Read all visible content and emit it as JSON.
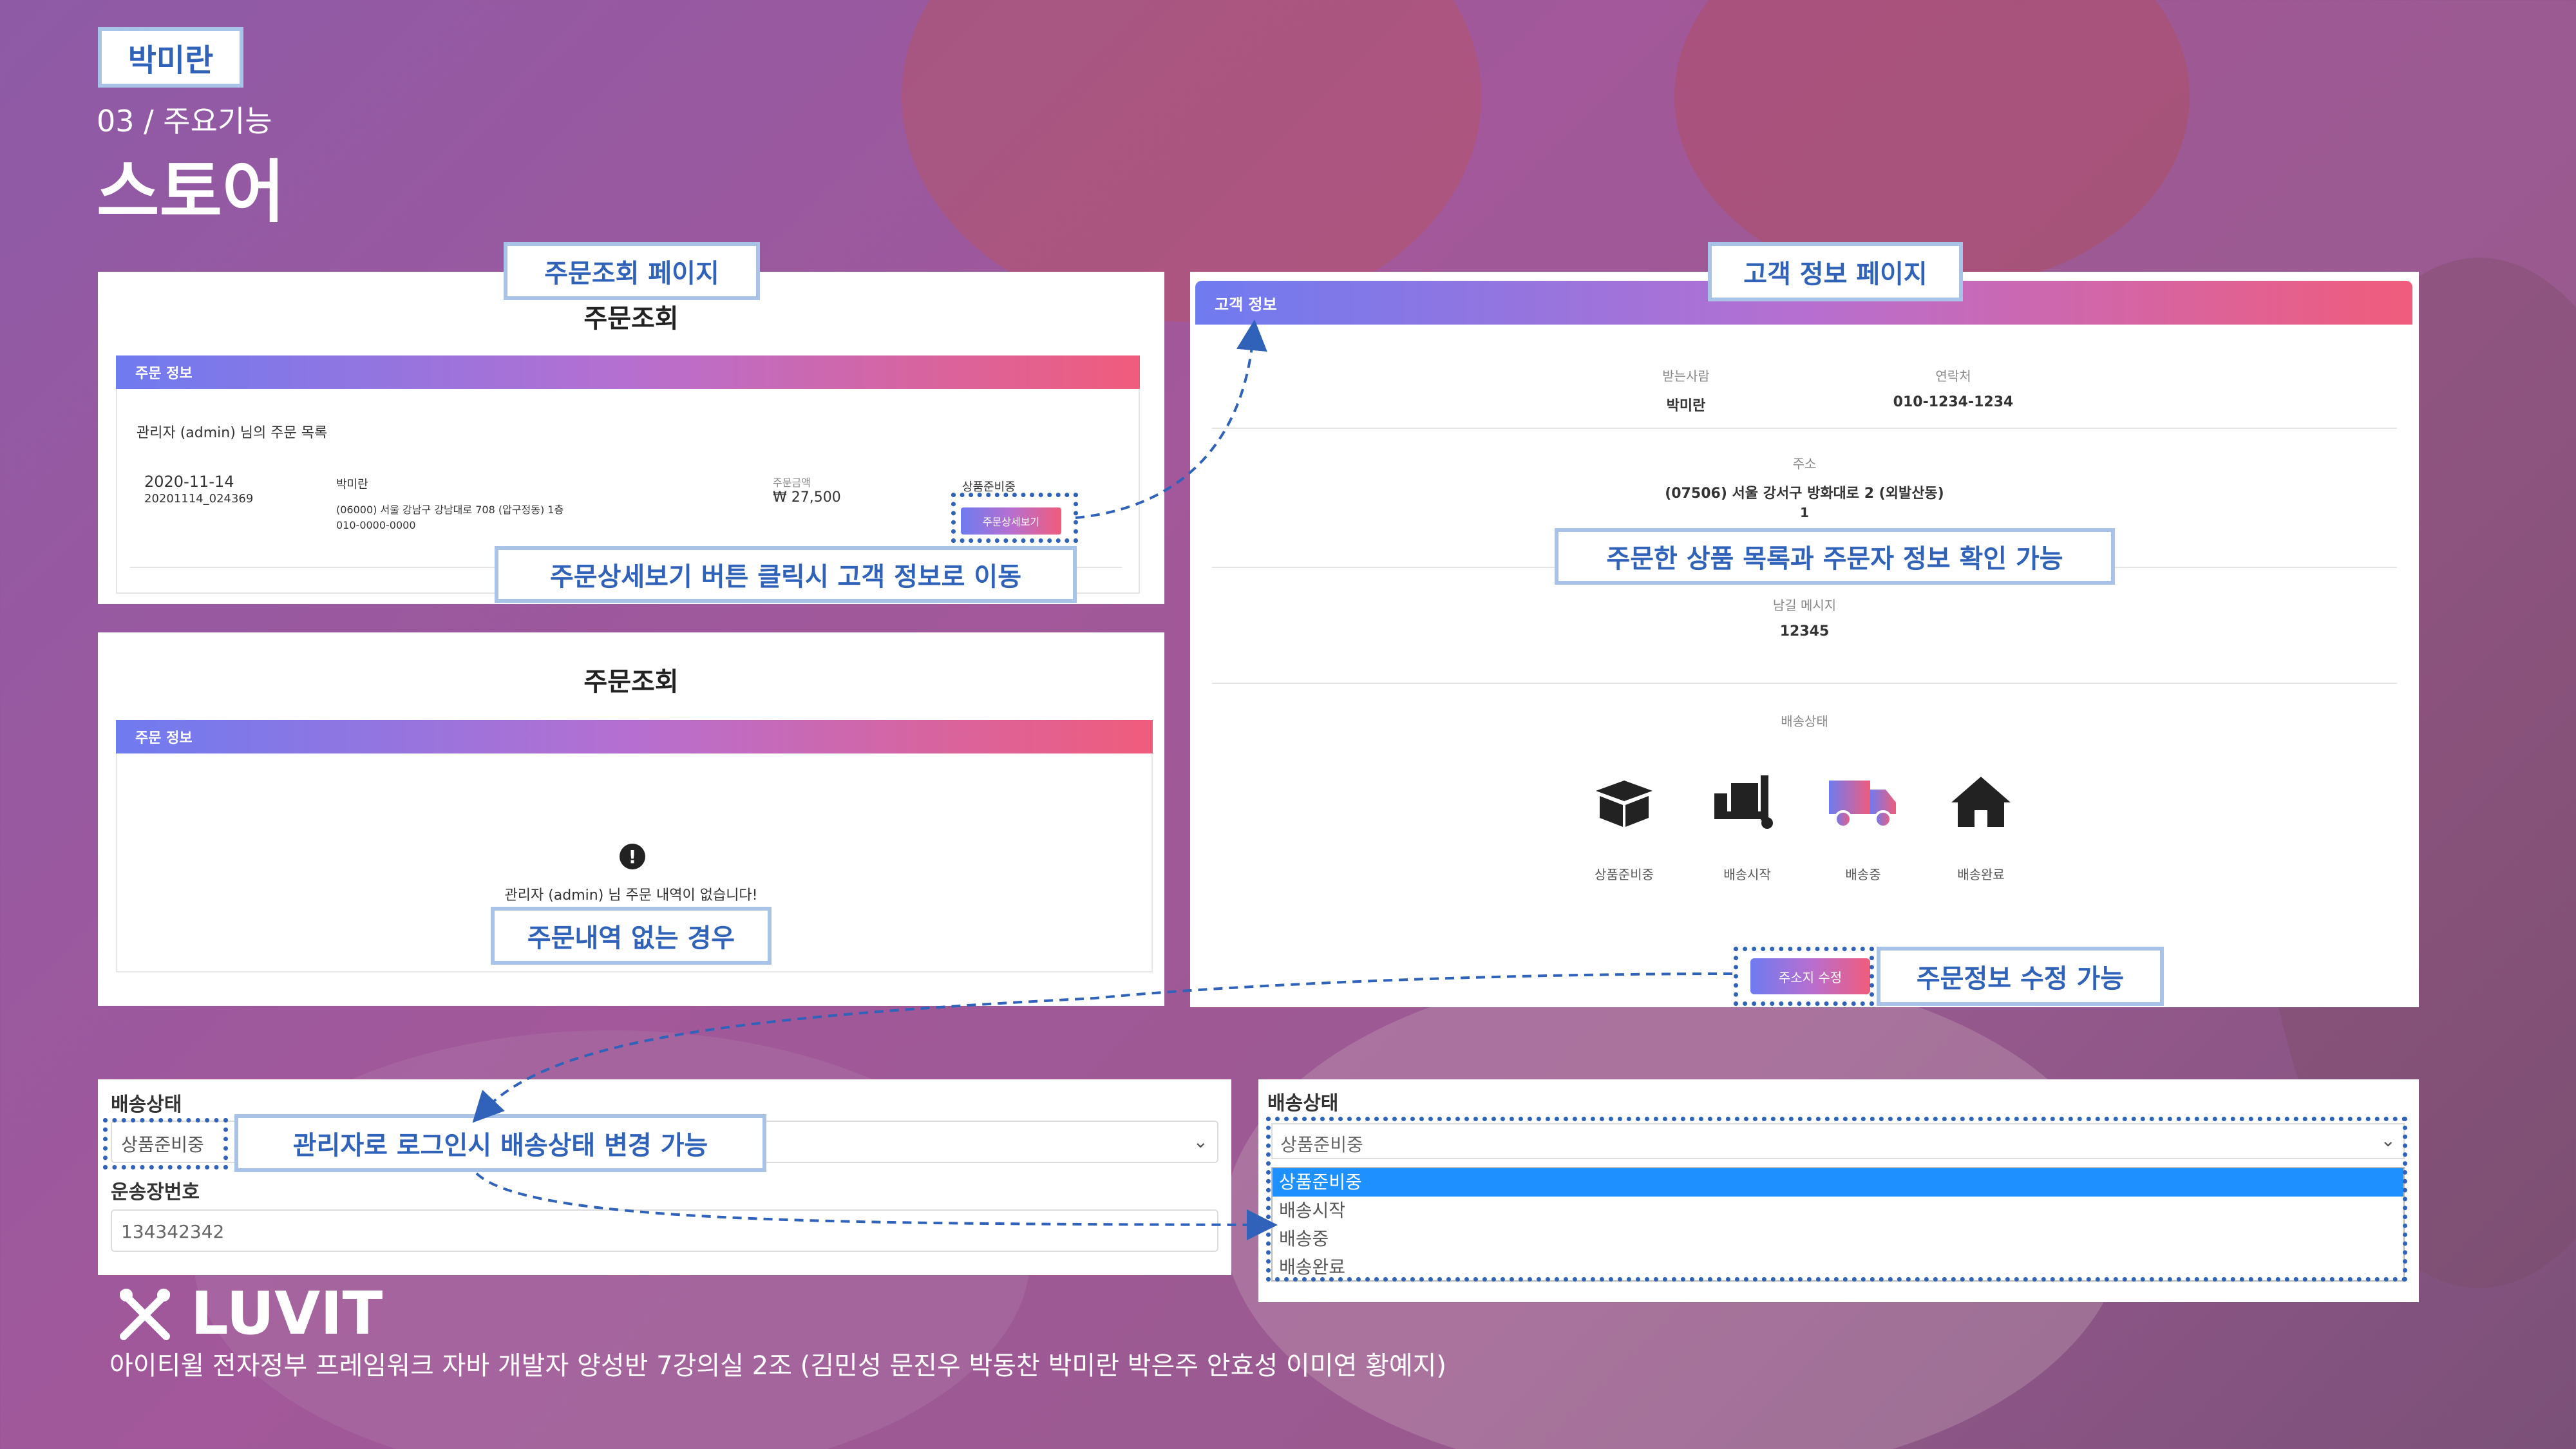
{
  "header": {
    "name_tag": "박미란",
    "section": "03 / 주요기능",
    "title": "스토어"
  },
  "order_page": {
    "callout": "주문조회 페이지",
    "heading": "주문조회",
    "bar": "주문 정보",
    "list_title": "관리자 (admin) 님의 주문 목록",
    "date": "2020-11-14",
    "order_no": "20201114_024369",
    "name": "박미란",
    "address": "(06000) 서울 강남구 강남대로 708 (압구정동) 1층",
    "phone": "010-0000-0000",
    "amount_label": "주문금액",
    "amount": "₩ 27,500",
    "status_label": "상품준비중",
    "detail_button": "주문상세보기",
    "detail_callout": "주문상세보기 버튼 클릭시 고객 정보로 이동"
  },
  "empty_page": {
    "heading": "주문조회",
    "bar": "주문 정보",
    "empty_text": "관리자 (admin) 님 주문 내역이 없습니다!",
    "callout": "주문내역 없는 경우"
  },
  "customer_page": {
    "callout": "고객 정보 페이지",
    "bar": "고객 정보",
    "receiver_label": "받는사람",
    "receiver": "박미란",
    "contact_label": "연락처",
    "contact": "010-1234-1234",
    "address_label": "주소",
    "address": "(07506) 서울 강서구 방화대로 2 (외발산동)",
    "address_extra": "1",
    "items_callout": "주문한 상품 목록과 주문자 정보 확인 가능",
    "memo_label": "남길 메시지",
    "memo": "12345",
    "delivery_label": "배송상태",
    "steps": [
      "상품준비중",
      "배송시작",
      "배송중",
      "배송완료"
    ],
    "edit_button": "주소지 수정",
    "edit_callout": "주문정보 수정 가능"
  },
  "delivery_form": {
    "status_label": "배송상태",
    "status_value": "상품준비중",
    "admin_callout": "관리자로 로그인시 배송상태 변경 가능",
    "tracking_label": "운송장번호",
    "tracking_value": "134342342"
  },
  "dropdown_panel": {
    "label": "배송상태",
    "selected": "상품준비중",
    "options": [
      "상품준비중",
      "배송시작",
      "배송중",
      "배송완료"
    ]
  },
  "footer": {
    "logo": "LUVIT",
    "credits": "아이티윌 전자정부 프레임워크 자바 개발자 양성반 7강의실 2조 (김민성 문진우 박동찬 박미란 박은주 안효성 이미연 황예지)"
  },
  "colors": {
    "accent": "#2f62b8",
    "callout_border": "#a9c3e8",
    "gradient_start": "#6f7bf0",
    "gradient_end": "#f05c7c",
    "selected_option": "#1e90ff"
  }
}
